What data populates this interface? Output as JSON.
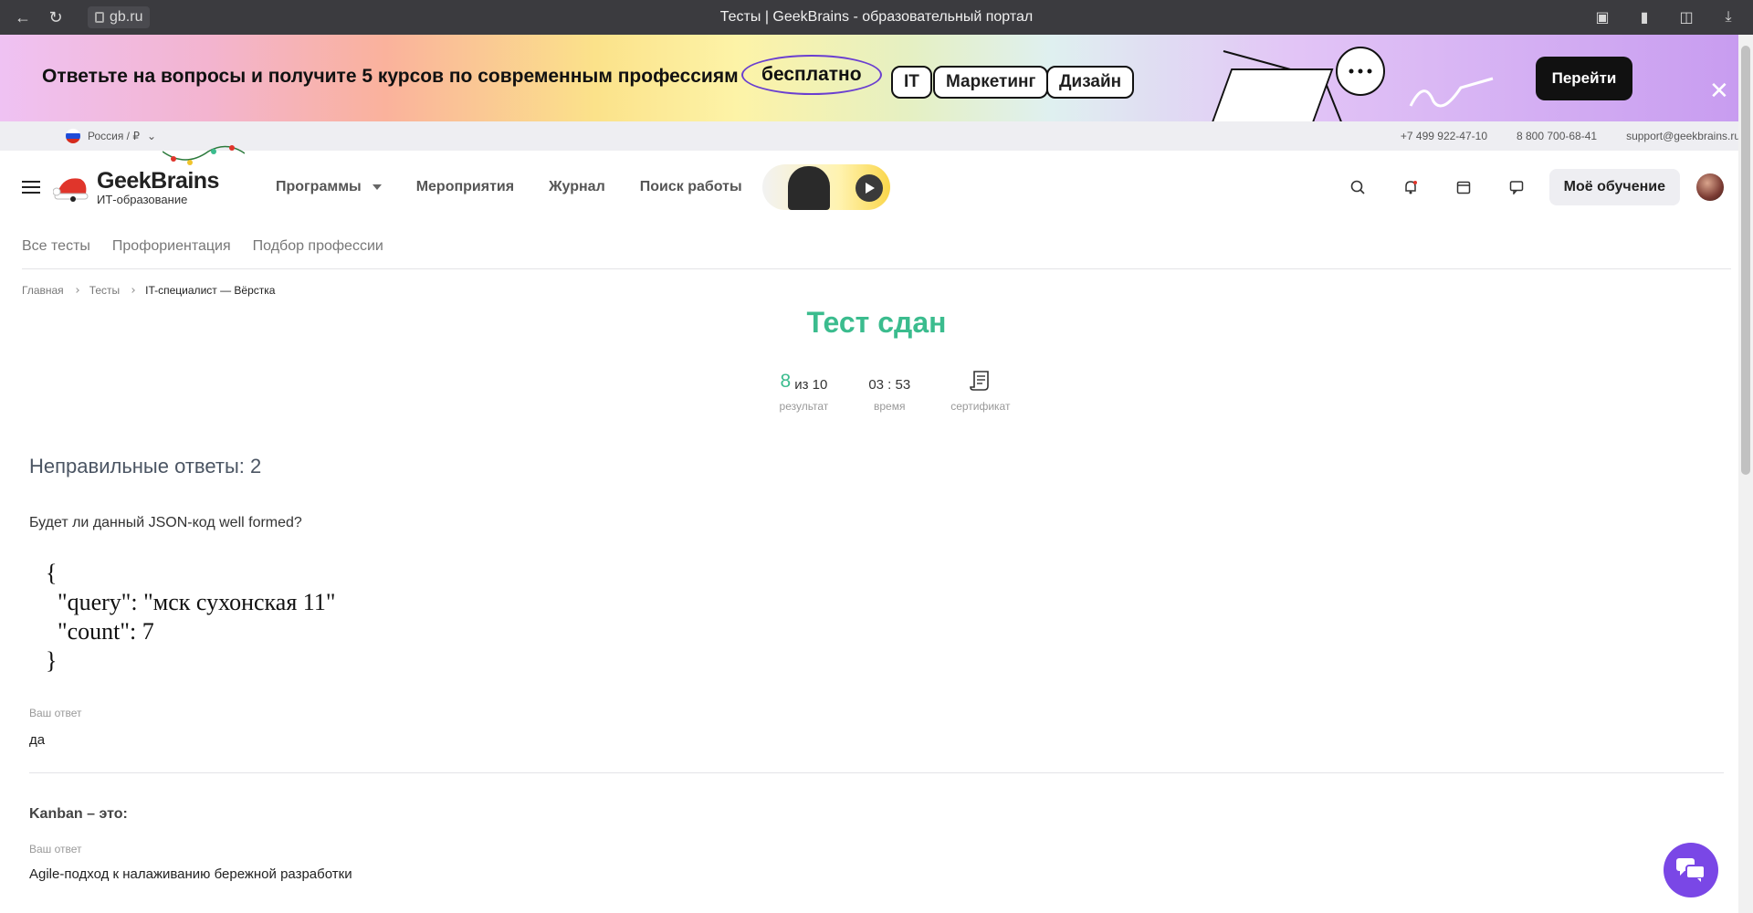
{
  "browser": {
    "url": "gb.ru",
    "tab_title": "Тесты | GeekBrains - образовательный портал"
  },
  "promo": {
    "text": "Ответьте на вопросы и получите 5 курсов по современным профессиям",
    "highlight": "бесплатно",
    "tags": [
      "IT",
      "Маркетинг",
      "Дизайн"
    ],
    "cta": "Перейти"
  },
  "infobar": {
    "region": "Россия / ₽",
    "phone1": "+7 499 922-47-10",
    "phone2": "8 800 700-68-41",
    "email": "support@geekbrains.ru"
  },
  "header": {
    "brand": "GeekBrains",
    "brand_sub": "ИТ-образование",
    "menu": [
      "Программы",
      "Мероприятия",
      "Журнал",
      "Поиск работы"
    ],
    "my_learning": "Моё обучение"
  },
  "subnav": [
    "Все тесты",
    "Профориентация",
    "Подбор профессии"
  ],
  "breadcrumbs": [
    "Главная",
    "Тесты",
    "IT-специалист — Вёрстка"
  ],
  "result": {
    "title": "Тест сдан",
    "score": "8",
    "score_total": "из 10",
    "score_label": "результат",
    "time": "03 : 53",
    "time_label": "время",
    "cert_label": "сертификат"
  },
  "wrong": {
    "title": "Неправильные ответы: 2",
    "items": [
      {
        "question": "Будет ли данный JSON-код well formed?",
        "code": "{\n  \"query\": \"мск сухонская 11\"\n  \"count\": 7\n}",
        "answer_label": "Ваш ответ",
        "answer": "да"
      },
      {
        "question": "Kanban – это:",
        "answer_label": "Ваш ответ",
        "answer": "Agile-подход к налаживанию бережной разработки"
      }
    ]
  },
  "colors": {
    "accent_green": "#3bbc8e",
    "chat_purple": "#7a47e6"
  }
}
